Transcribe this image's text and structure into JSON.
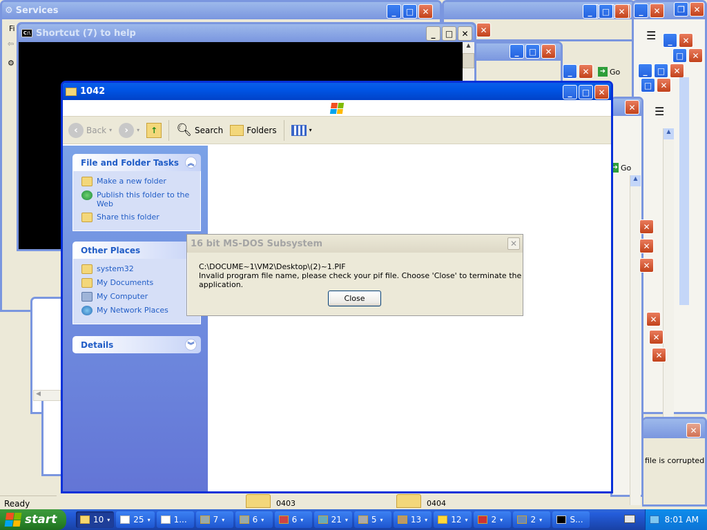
{
  "background_windows": {
    "services_title": "Services",
    "services_menu_fragment": "Fi",
    "console_title": "Shortcut (7) to help",
    "go_label": "Go",
    "go_label_2": "Go",
    "corrupted_text": "file is corrupted.",
    "folder_items": [
      {
        "label": "0403"
      },
      {
        "label": "0404"
      }
    ],
    "status_text": "Ready"
  },
  "explorer": {
    "title": "1042",
    "toolbar": {
      "back_label": "Back",
      "search_label": "Search",
      "folders_label": "Folders"
    },
    "file_folder_tasks": {
      "header": "File and Folder Tasks",
      "items": [
        {
          "label": "Make a new folder",
          "icon": "new-folder-icon"
        },
        {
          "label": "Publish this folder to the Web",
          "icon": "globe-icon"
        },
        {
          "label": "Share this folder",
          "icon": "share-folder-icon"
        }
      ]
    },
    "other_places": {
      "header": "Other Places",
      "items": [
        {
          "label": "system32",
          "icon": "folder-icon"
        },
        {
          "label": "My Documents",
          "icon": "my-documents-icon"
        },
        {
          "label": "My Computer",
          "icon": "my-computer-icon"
        },
        {
          "label": "My Network Places",
          "icon": "network-places-icon"
        }
      ]
    },
    "details": {
      "header": "Details"
    }
  },
  "dialog": {
    "title": "16 bit MS-DOS Subsystem",
    "line1": "C:\\DOCUME~1\\VM2\\Desktop\\(2)~1.PIF",
    "line2": "Invalid program file name, please check your pif file. Choose 'Close' to terminate the application.",
    "close_button": "Close"
  },
  "taskbar": {
    "start_label": "start",
    "tasks": [
      {
        "label": "10",
        "active": true
      },
      {
        "label": "25"
      },
      {
        "label": "1..."
      },
      {
        "label": "7"
      },
      {
        "label": "6"
      },
      {
        "label": "6"
      },
      {
        "label": "21"
      },
      {
        "label": "5"
      },
      {
        "label": "13"
      },
      {
        "label": "12"
      },
      {
        "label": "2"
      },
      {
        "label": "2"
      },
      {
        "label": "S..."
      }
    ],
    "clock": "8:01 AM"
  },
  "colors": {
    "title_active": "#0055E5",
    "taskpane_blue": "#7BA2E7",
    "link_blue": "#215DC6",
    "start_green": "#2E8B2E"
  }
}
